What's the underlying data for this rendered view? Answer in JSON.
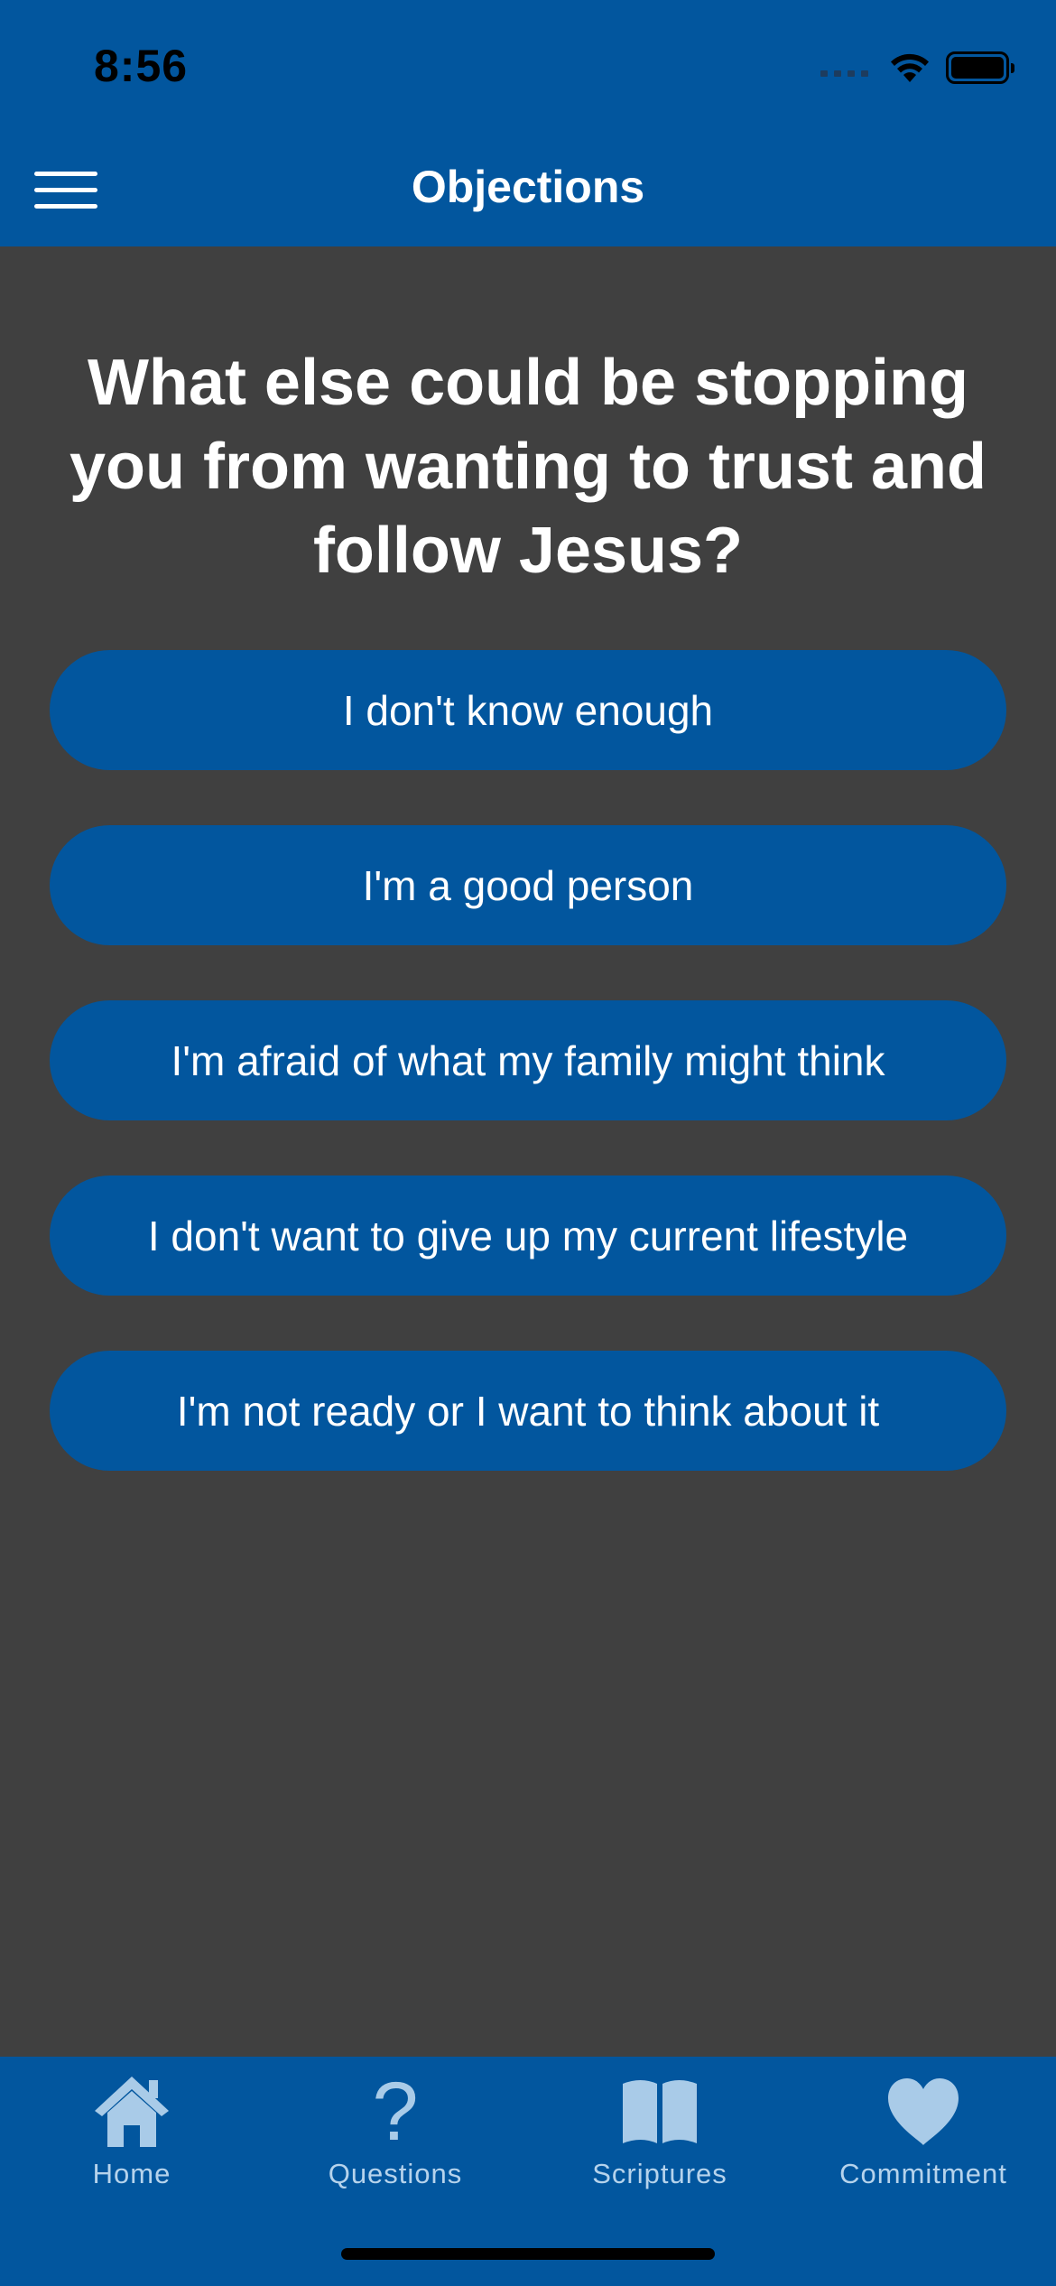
{
  "status_bar": {
    "time": "8:56"
  },
  "header": {
    "title": "Objections",
    "menu_icon": "hamburger-menu-icon"
  },
  "main": {
    "question": "What else could be stopping you from wanting to trust and follow Jesus?",
    "options": [
      {
        "label": "I don't know enough"
      },
      {
        "label": "I'm a good person"
      },
      {
        "label": "I'm afraid of what my family might think"
      },
      {
        "label": "I don't want to give up my current lifestyle"
      },
      {
        "label": "I'm not ready or I want to think about it"
      }
    ]
  },
  "tab_bar": {
    "tabs": [
      {
        "label": "Home",
        "icon": "house-icon"
      },
      {
        "label": "Questions",
        "icon": "question-mark-icon"
      },
      {
        "label": "Scriptures",
        "icon": "open-book-icon"
      },
      {
        "label": "Commitment",
        "icon": "heart-icon"
      }
    ]
  },
  "colors": {
    "primary": "#02569e",
    "background": "#404040",
    "text": "#ffffff",
    "tab_label": "#b6d3ec",
    "tab_icon": "#a9cbe8"
  }
}
